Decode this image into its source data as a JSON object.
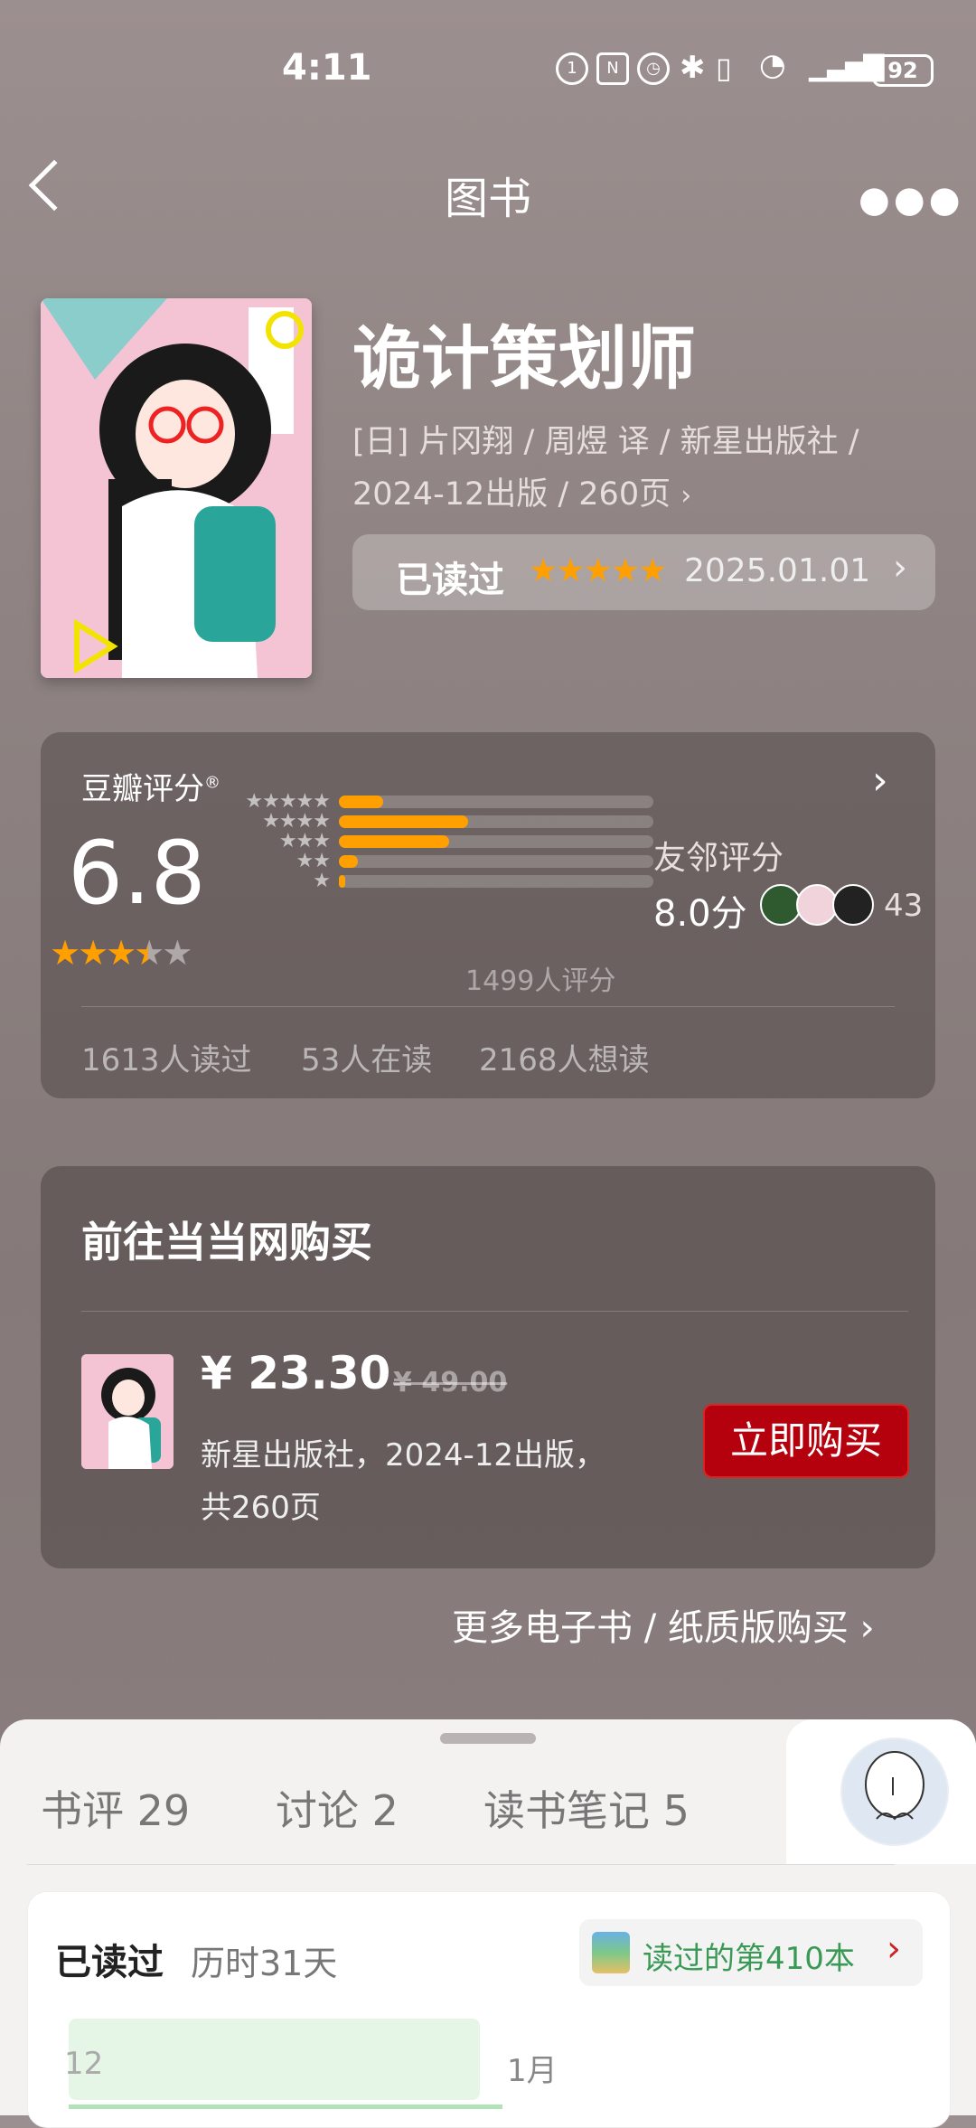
{
  "status_bar": {
    "time": "4:11",
    "battery": "92"
  },
  "nav": {
    "title": "图书"
  },
  "book": {
    "title": "诡计策划师",
    "meta_line1": "[日] 片冈翔 / 周煜 译 / 新星出版社 /",
    "meta_line2": "2024-12出版 / 260页",
    "read_label": "已读过",
    "read_stars": "★★★★★",
    "read_date": "2025.01.01"
  },
  "rating": {
    "header": "豆瓣评分",
    "registered_mark": "®",
    "score": "6.8",
    "score_stars": 3.5,
    "distribution": [
      {
        "stars": "★★★★★",
        "fraction": 0.14
      },
      {
        "stars": "★★★★",
        "fraction": 0.41
      },
      {
        "stars": "★★★",
        "fraction": 0.35
      },
      {
        "stars": "★★",
        "fraction": 0.06
      },
      {
        "stars": "★",
        "fraction": 0.02
      }
    ],
    "count": "1499人评分",
    "friend_label": "友邻评分",
    "friend_score": "8.0分",
    "friend_count": "43",
    "stats": [
      "1613人读过",
      "53人在读",
      "2168人想读"
    ]
  },
  "buy": {
    "header": "前往当当网购买",
    "price": "¥ 23.30",
    "original_price": "¥ 49.00",
    "desc_line1": "新星出版社，2024-12出版，",
    "desc_line2": "共260页",
    "button": "立即购买"
  },
  "more_buy": "更多电子书 / 纸质版购买",
  "sheet": {
    "tabs": [
      "书评 29",
      "讨论 2",
      "读书笔记 5"
    ],
    "read_done": "已读过",
    "duration": "历时31天",
    "count_text": "读过的第410本",
    "months": [
      "12",
      "1月"
    ]
  },
  "colors": {
    "star": "#ff9f00",
    "buy_button": "#b5000e",
    "green": "#3a9a55"
  }
}
